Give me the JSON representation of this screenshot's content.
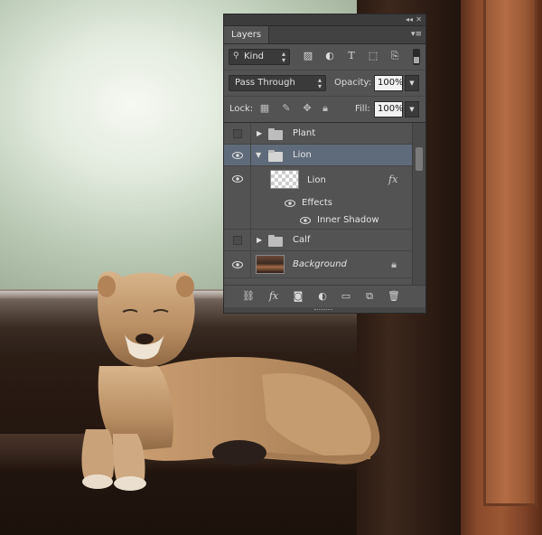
{
  "panel": {
    "tab_label": "Layers",
    "filter": {
      "kind_label": "Kind"
    },
    "blend_mode": "Pass Through",
    "opacity_label": "Opacity:",
    "opacity_value": "100%",
    "lock_label": "Lock:",
    "fill_label": "Fill:",
    "fill_value": "100%",
    "layers": [
      {
        "name": "Plant",
        "type": "group",
        "visible": false,
        "expanded": false
      },
      {
        "name": "Lion",
        "type": "group",
        "visible": true,
        "expanded": true,
        "selected": true
      },
      {
        "name": "Lion",
        "type": "layer",
        "visible": true,
        "has_fx": true
      },
      {
        "name": "Effects",
        "type": "effects-header",
        "visible": true
      },
      {
        "name": "Inner Shadow",
        "type": "effect",
        "visible": true
      },
      {
        "name": "Calf",
        "type": "group",
        "visible": false,
        "expanded": false
      },
      {
        "name": "Background",
        "type": "background",
        "visible": true,
        "locked": true
      }
    ]
  },
  "colors": {
    "panel_bg": "#535353",
    "selected_row": "#5f6b7a",
    "field_bg": "#f2f2f2"
  }
}
